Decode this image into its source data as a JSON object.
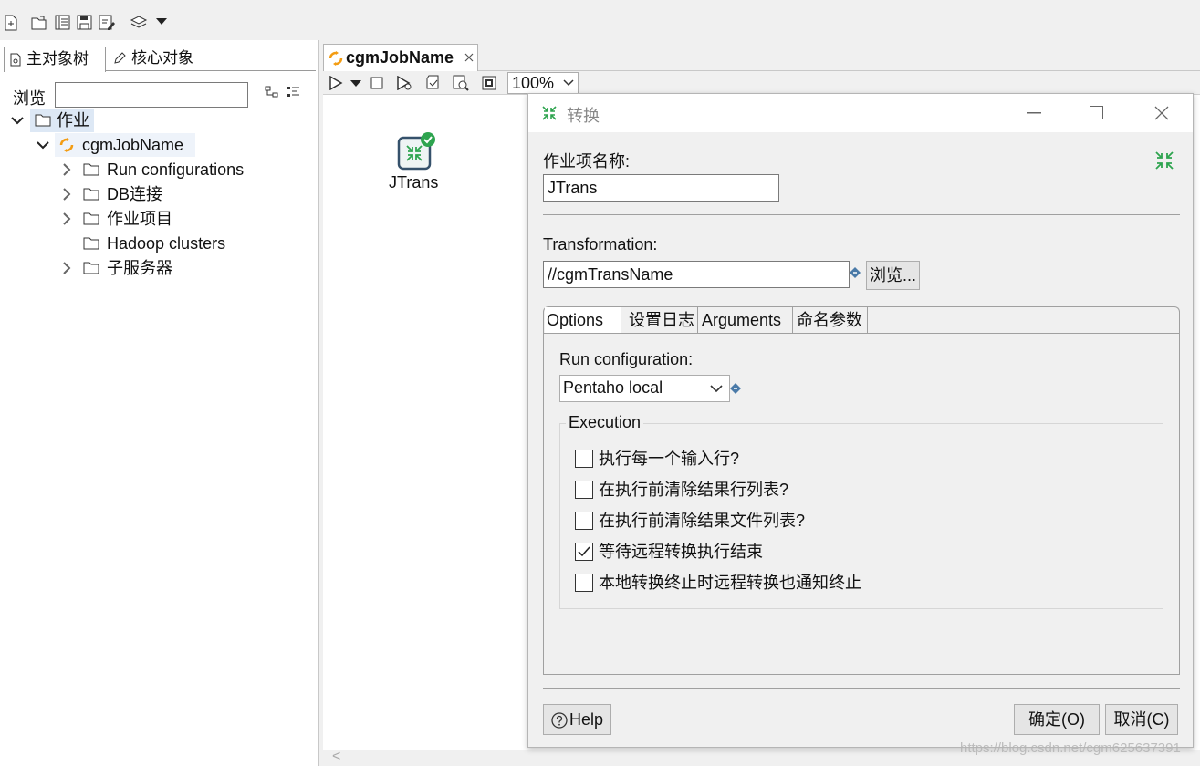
{
  "toolbar": {
    "icons": [
      "new-file-icon",
      "open-icon",
      "explorer-icon",
      "save-icon",
      "save-as-icon",
      "layers-icon",
      "dropdown-arrow-icon"
    ]
  },
  "left_panel": {
    "tabs": [
      {
        "label": "主对象树"
      },
      {
        "label": "核心对象"
      }
    ],
    "search_label": "浏览",
    "search_value": "",
    "tree": {
      "root": "作业",
      "job": "cgmJobName",
      "children": [
        "Run configurations",
        "DB连接",
        "作业项目",
        "Hadoop clusters",
        "子服务器"
      ]
    }
  },
  "editor": {
    "tab_title": "cgmJobName",
    "zoom": "100%",
    "canvas_entry": "JTrans",
    "scroll_arrow": "<"
  },
  "dialog": {
    "title": "转换",
    "entry_name_label": "作业项名称:",
    "entry_name_value": "JTrans",
    "transformation_label": "Transformation:",
    "transformation_value": "//cgmTransName",
    "browse_button": "浏览...",
    "tabs": [
      "Options",
      "设置日志",
      "Arguments",
      "命名参数"
    ],
    "active_tab": "Options",
    "run_config_label": "Run configuration:",
    "run_config_value": "Pentaho local",
    "execution_label": "Execution",
    "checkboxes": [
      {
        "label": "执行每一个输入行?",
        "checked": false
      },
      {
        "label": "在执行前清除结果行列表?",
        "checked": false
      },
      {
        "label": "在执行前清除结果文件列表?",
        "checked": false
      },
      {
        "label": "等待远程转换执行结束",
        "checked": true
      },
      {
        "label": "本地转换终止时远程转换也通知终止",
        "checked": false
      }
    ],
    "help_button": "Help",
    "ok_button": "确定(O)",
    "cancel_button": "取消(C)"
  },
  "watermark": "https://blog.csdn.net/cgm625637391",
  "colors": {
    "accent_green": "#2ea44f",
    "job_orange": "#f39c12",
    "selection_blue": "#dde8f5"
  }
}
